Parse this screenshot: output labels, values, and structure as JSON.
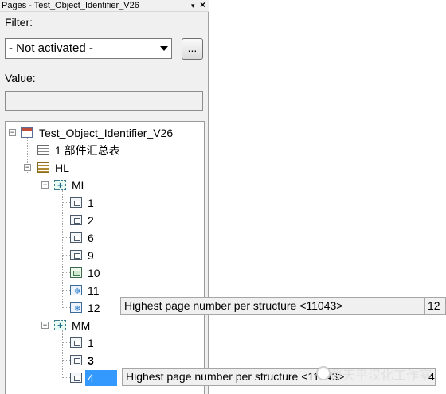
{
  "panel": {
    "title": "Pages - Test_Object_Identifier_V26",
    "pin_glyph": "▾",
    "close_glyph": "×",
    "filter_label": "Filter:",
    "filter_value": "- Not activated -",
    "more_button": "...",
    "value_label": "Value:",
    "value_text": ""
  },
  "tree": {
    "root": {
      "label": "Test_Object_Identifier_V26",
      "icon": "project-icon",
      "expander": "−"
    },
    "summary": {
      "label": "1 部件汇总表",
      "icon": "table-icon"
    },
    "hl": {
      "label": "HL",
      "icon": "list-icon",
      "expander": "−"
    },
    "ml": {
      "label": "ML",
      "icon": "structure-icon",
      "expander": "−"
    },
    "ml_pages": [
      {
        "label": "1",
        "icon": "page-icon"
      },
      {
        "label": "2",
        "icon": "page-icon"
      },
      {
        "label": "6",
        "icon": "page-icon"
      },
      {
        "label": "9",
        "icon": "page-icon"
      },
      {
        "label": "10",
        "icon": "graphic-page-icon"
      },
      {
        "label": "11",
        "icon": "snowflake-page-icon"
      },
      {
        "label": "12",
        "icon": "snowflake-page-icon"
      }
    ],
    "mm": {
      "label": "MM",
      "icon": "structure-icon",
      "expander": "−"
    },
    "mm_pages": [
      {
        "label": "1",
        "icon": "page-icon"
      },
      {
        "label": "3",
        "icon": "page-icon"
      },
      {
        "label": "4",
        "icon": "page-icon"
      }
    ]
  },
  "tooltips": [
    {
      "text": "Highest page number per structure <11043>",
      "value": "12"
    },
    {
      "text": "Highest page number per structure <11043>",
      "value": "4"
    }
  ],
  "watermark": {
    "text": "曹天平汉化工作室"
  },
  "colors": {
    "selection": "#3399ff",
    "tooltip_bg": "#f0f0f0",
    "panel_bg": "#f0f0f0"
  }
}
